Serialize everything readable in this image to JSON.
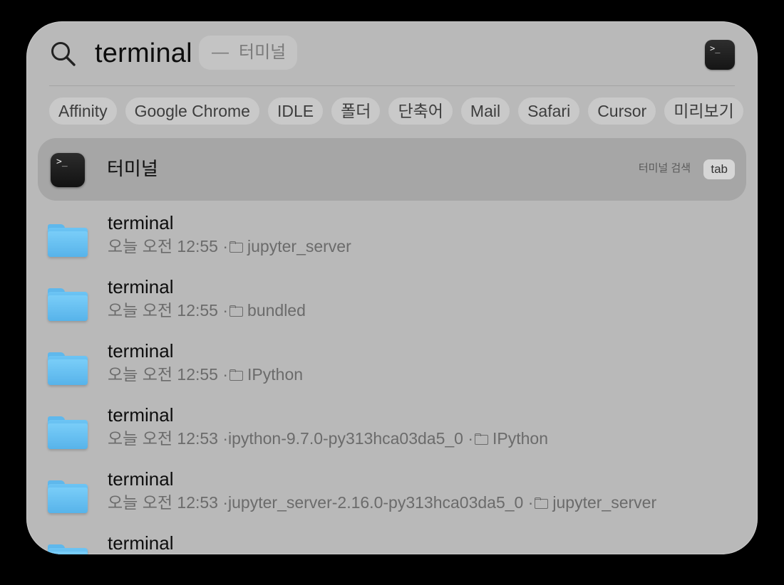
{
  "search": {
    "query": "terminal",
    "suggestion_dash": "—",
    "suggestion": "터미널",
    "top_app_icon": "terminal-app-icon"
  },
  "chips": [
    "Affinity",
    "Google Chrome",
    "IDLE",
    "폴더",
    "단축어",
    "Mail",
    "Safari",
    "Cursor",
    "미리보기"
  ],
  "top_hit": {
    "title": "터미널",
    "icon": "terminal-app-icon",
    "hint": "터미널 검색",
    "key": "tab",
    "glyph": ">_"
  },
  "results": [
    {
      "name": "terminal",
      "time": "오늘 오전 12:55 · ",
      "path": "",
      "folder": "jupyter_server"
    },
    {
      "name": "terminal",
      "time": "오늘 오전 12:55 · ",
      "path": "",
      "folder": "bundled"
    },
    {
      "name": "terminal",
      "time": "오늘 오전 12:55 · ",
      "path": "",
      "folder": "IPython"
    },
    {
      "name": "terminal",
      "time": "오늘 오전 12:53 · ",
      "path": "ipython-9.7.0-py313hca03da5_0 · ",
      "folder": "IPython"
    },
    {
      "name": "terminal",
      "time": "오늘 오전 12:53 · ",
      "path": "jupyter_server-2.16.0-py313hca03da5_0 · ",
      "folder": "jupyter_server"
    },
    {
      "name": "terminal",
      "time": "",
      "path": "",
      "folder": ""
    }
  ],
  "icons": {
    "search": "search-icon",
    "folder": "folder-icon",
    "mini_folder": "folder-small-icon"
  },
  "colors": {
    "panel_bg": "#b9b9b9",
    "selected_row": "#a6a6a6",
    "folder_blue": "#5fb8ec"
  }
}
